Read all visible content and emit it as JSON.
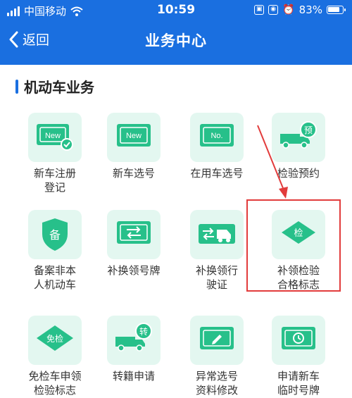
{
  "status_bar": {
    "carrier": "中国移动",
    "time": "10:59",
    "battery": "83%"
  },
  "nav": {
    "back_label": "返回",
    "title": "业务中心"
  },
  "section": {
    "title": "机动车业务"
  },
  "items": [
    {
      "label": "新车注册\n登记",
      "icon": "new-registration-icon"
    },
    {
      "label": "新车选号",
      "icon": "new-plate-icon"
    },
    {
      "label": "在用车选号",
      "icon": "plate-number-icon"
    },
    {
      "label": "检验预约",
      "icon": "inspection-booking-icon"
    },
    {
      "label": "备案非本\n人机动车",
      "icon": "record-shield-icon"
    },
    {
      "label": "补换领号牌",
      "icon": "swap-plate-icon"
    },
    {
      "label": "补换领行\n驶证",
      "icon": "swap-license-icon"
    },
    {
      "label": "补领检验\n合格标志",
      "icon": "inspection-badge-icon"
    },
    {
      "label": "免检车申领\n检验标志",
      "icon": "exempt-badge-icon"
    },
    {
      "label": "转籍申请",
      "icon": "transfer-truck-icon"
    },
    {
      "label": "异常选号\n资料修改",
      "icon": "edit-document-icon"
    },
    {
      "label": "申请新车\n临时号牌",
      "icon": "temp-plate-icon"
    }
  ],
  "colors": {
    "header": "#1a6fe0",
    "icon_green": "#27c08a",
    "icon_bg": "#e3f7f0",
    "highlight": "#e23c3c"
  },
  "icon_text": {
    "new": "New",
    "no": "No.",
    "yu": "预",
    "bei": "备",
    "jian": "检",
    "mianjian": "免检",
    "zhuan": "转"
  }
}
